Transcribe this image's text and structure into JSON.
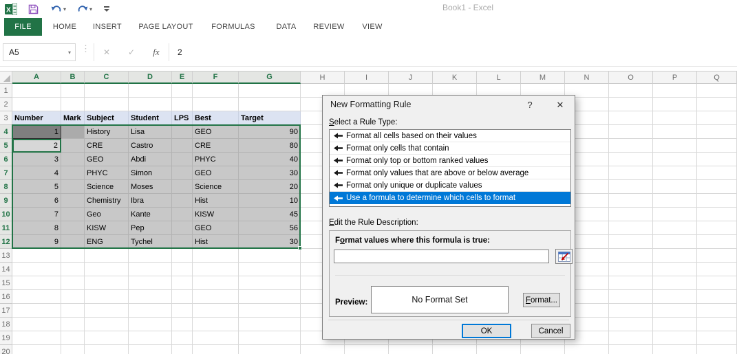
{
  "titlebar": {
    "title": "Book1 - Excel"
  },
  "qat": {
    "excel_logo": "excel-logo",
    "save": "save",
    "undo": "undo",
    "redo": "redo",
    "customize": "customize-quick-access-toolbar"
  },
  "ribbon": {
    "active_tab": "FILE",
    "tabs": [
      "FILE",
      "HOME",
      "INSERT",
      "PAGE LAYOUT",
      "FORMULAS",
      "DATA",
      "REVIEW",
      "VIEW"
    ]
  },
  "formula_bar": {
    "name_box": "A5",
    "name_box_arrow": "▾",
    "dots": "⋮",
    "cancel_icon": "✕",
    "enter_icon": "✓",
    "fx_icon": "fx",
    "value": "2"
  },
  "grid": {
    "columns": [
      "A",
      "B",
      "C",
      "D",
      "E",
      "F",
      "G",
      "H",
      "I",
      "J",
      "K",
      "L",
      "M",
      "N",
      "O",
      "P",
      "Q"
    ],
    "selected_columns": [
      "A",
      "B",
      "C",
      "D",
      "E",
      "F",
      "G"
    ],
    "visible_rows": 20,
    "selected_row_start": 4,
    "selected_row_end": 12,
    "active_cell": "A5",
    "cells": {
      "3": {
        "A": "Number",
        "B": "Mark",
        "C": "Subject",
        "D": "Student",
        "E": "LPS",
        "F": "Best",
        "G": "Target"
      },
      "4": {
        "A": "1",
        "C": "History",
        "D": "Lisa",
        "F": "GEO",
        "G": "90"
      },
      "5": {
        "A": "2",
        "C": "CRE",
        "D": "Castro",
        "F": "CRE",
        "G": "80"
      },
      "6": {
        "A": "3",
        "C": "GEO",
        "D": "Abdi",
        "F": "PHYC",
        "G": "40"
      },
      "7": {
        "A": "4",
        "C": "PHYC",
        "D": "Simon",
        "F": "GEO",
        "G": "30"
      },
      "8": {
        "A": "5",
        "C": "Science",
        "D": "Moses",
        "F": "Science",
        "G": "20"
      },
      "9": {
        "A": "6",
        "C": "Chemistry",
        "D": "Ibra",
        "F": "Hist",
        "G": "10"
      },
      "10": {
        "A": "7",
        "C": "Geo",
        "D": "Kante",
        "F": "KISW",
        "G": "45"
      },
      "11": {
        "A": "8",
        "C": "KISW",
        "D": "Pep",
        "F": "GEO",
        "G": "56"
      },
      "12": {
        "A": "9",
        "C": "ENG",
        "D": "Tychel",
        "F": "Hist",
        "G": "30"
      }
    }
  },
  "dialog": {
    "title": "New Formatting Rule",
    "help_icon": "?",
    "close_icon": "✕",
    "rule_type_label": "Select a Rule Type:",
    "rule_types": [
      "Format all cells based on their values",
      "Format only cells that contain",
      "Format only top or bottom ranked values",
      "Format only values that are above or below average",
      "Format only unique or duplicate values",
      "Use a formula to determine which cells to format"
    ],
    "selected_rule_index": 5,
    "description_label": "Edit the Rule Description:",
    "formula_label": "Format values where this formula is true:",
    "formula_value": "",
    "preview_label": "Preview:",
    "preview_text": "No Format Set",
    "format_button": "Format...",
    "ok_button": "OK",
    "cancel_button": "Cancel"
  },
  "colors": {
    "excel_green": "#217346",
    "selection_blue": "#0078d7",
    "header_row_fill": "#dce3f2",
    "selection_fill": "#c8c8c8",
    "active_cell_fill": "#d7d7d7",
    "cell_a4_fill": "#7f7f7f",
    "cell_b4_fill": "#ababab",
    "save_icon_purple": "#8e4fbd",
    "undo_redo_blue": "#3566b0",
    "title_text": "#ababab"
  }
}
